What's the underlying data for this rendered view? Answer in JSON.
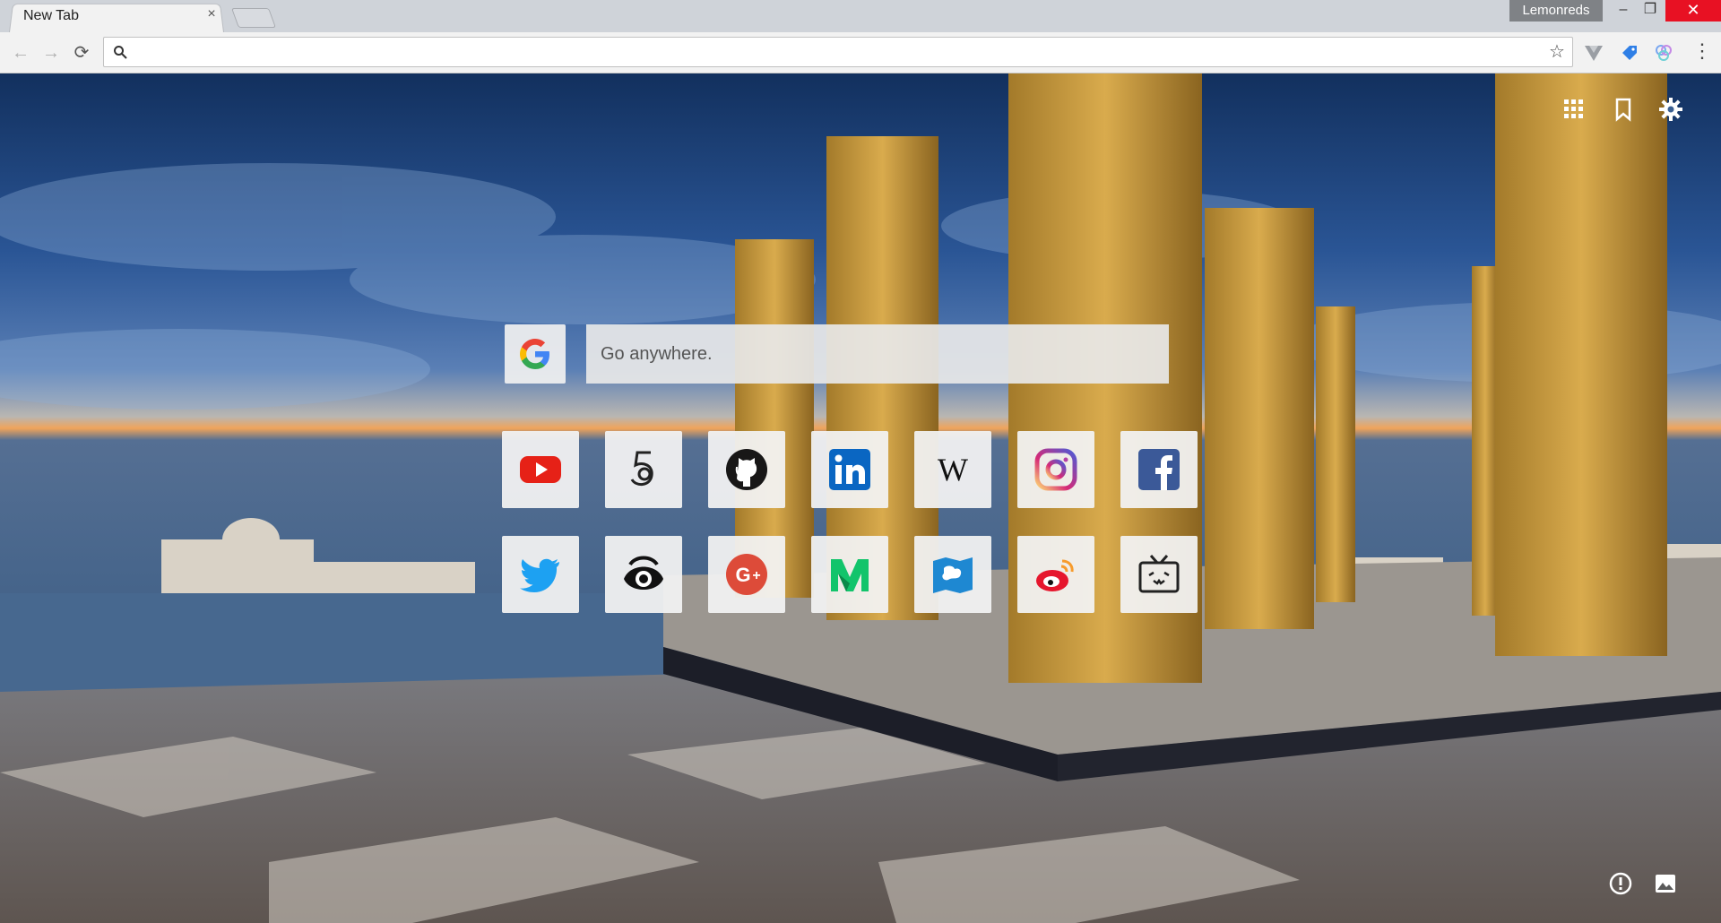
{
  "tab": {
    "title": "New Tab",
    "close": "×"
  },
  "profile": {
    "name": "Lemonreds"
  },
  "window": {
    "minimize": "–",
    "maximize": "❐",
    "close": "✕"
  },
  "toolbar": {
    "back": "←",
    "forward": "→",
    "reload": "⟳",
    "address_value": "",
    "star": "☆",
    "menu": "⋮"
  },
  "search": {
    "placeholder": "Go anywhere."
  },
  "icons": {
    "top_right": [
      "apps-grid-icon",
      "bookmark-icon",
      "settings-gear-icon"
    ],
    "bottom_right": [
      "info-icon",
      "image-icon"
    ]
  },
  "shortcuts": [
    {
      "name": "youtube",
      "icon": "youtube-icon",
      "color": "#e62117"
    },
    {
      "name": "500px",
      "icon": "500px-icon",
      "color": "#222222"
    },
    {
      "name": "github",
      "icon": "github-icon",
      "color": "#181717"
    },
    {
      "name": "linkedin",
      "icon": "linkedin-icon",
      "color": "#0a66c2"
    },
    {
      "name": "wikipedia",
      "icon": "wikipedia-icon",
      "color": "#111111"
    },
    {
      "name": "instagram",
      "icon": "instagram-icon",
      "color": "#c13584"
    },
    {
      "name": "facebook",
      "icon": "facebook-icon",
      "color": "#3b5998"
    },
    {
      "name": "twitter",
      "icon": "twitter-icon",
      "color": "#1da1f2"
    },
    {
      "name": "eye",
      "icon": "eye-icon",
      "color": "#111111"
    },
    {
      "name": "google-plus",
      "icon": "google-plus-icon",
      "color": "#dd4b39"
    },
    {
      "name": "medium",
      "icon": "medium-icon",
      "color": "#12c46b"
    },
    {
      "name": "map",
      "icon": "map-icon",
      "color": "#1e88d2"
    },
    {
      "name": "weibo",
      "icon": "weibo-icon",
      "color": "#e6162d"
    },
    {
      "name": "bilibili",
      "icon": "tv-icon",
      "color": "#222222"
    }
  ]
}
